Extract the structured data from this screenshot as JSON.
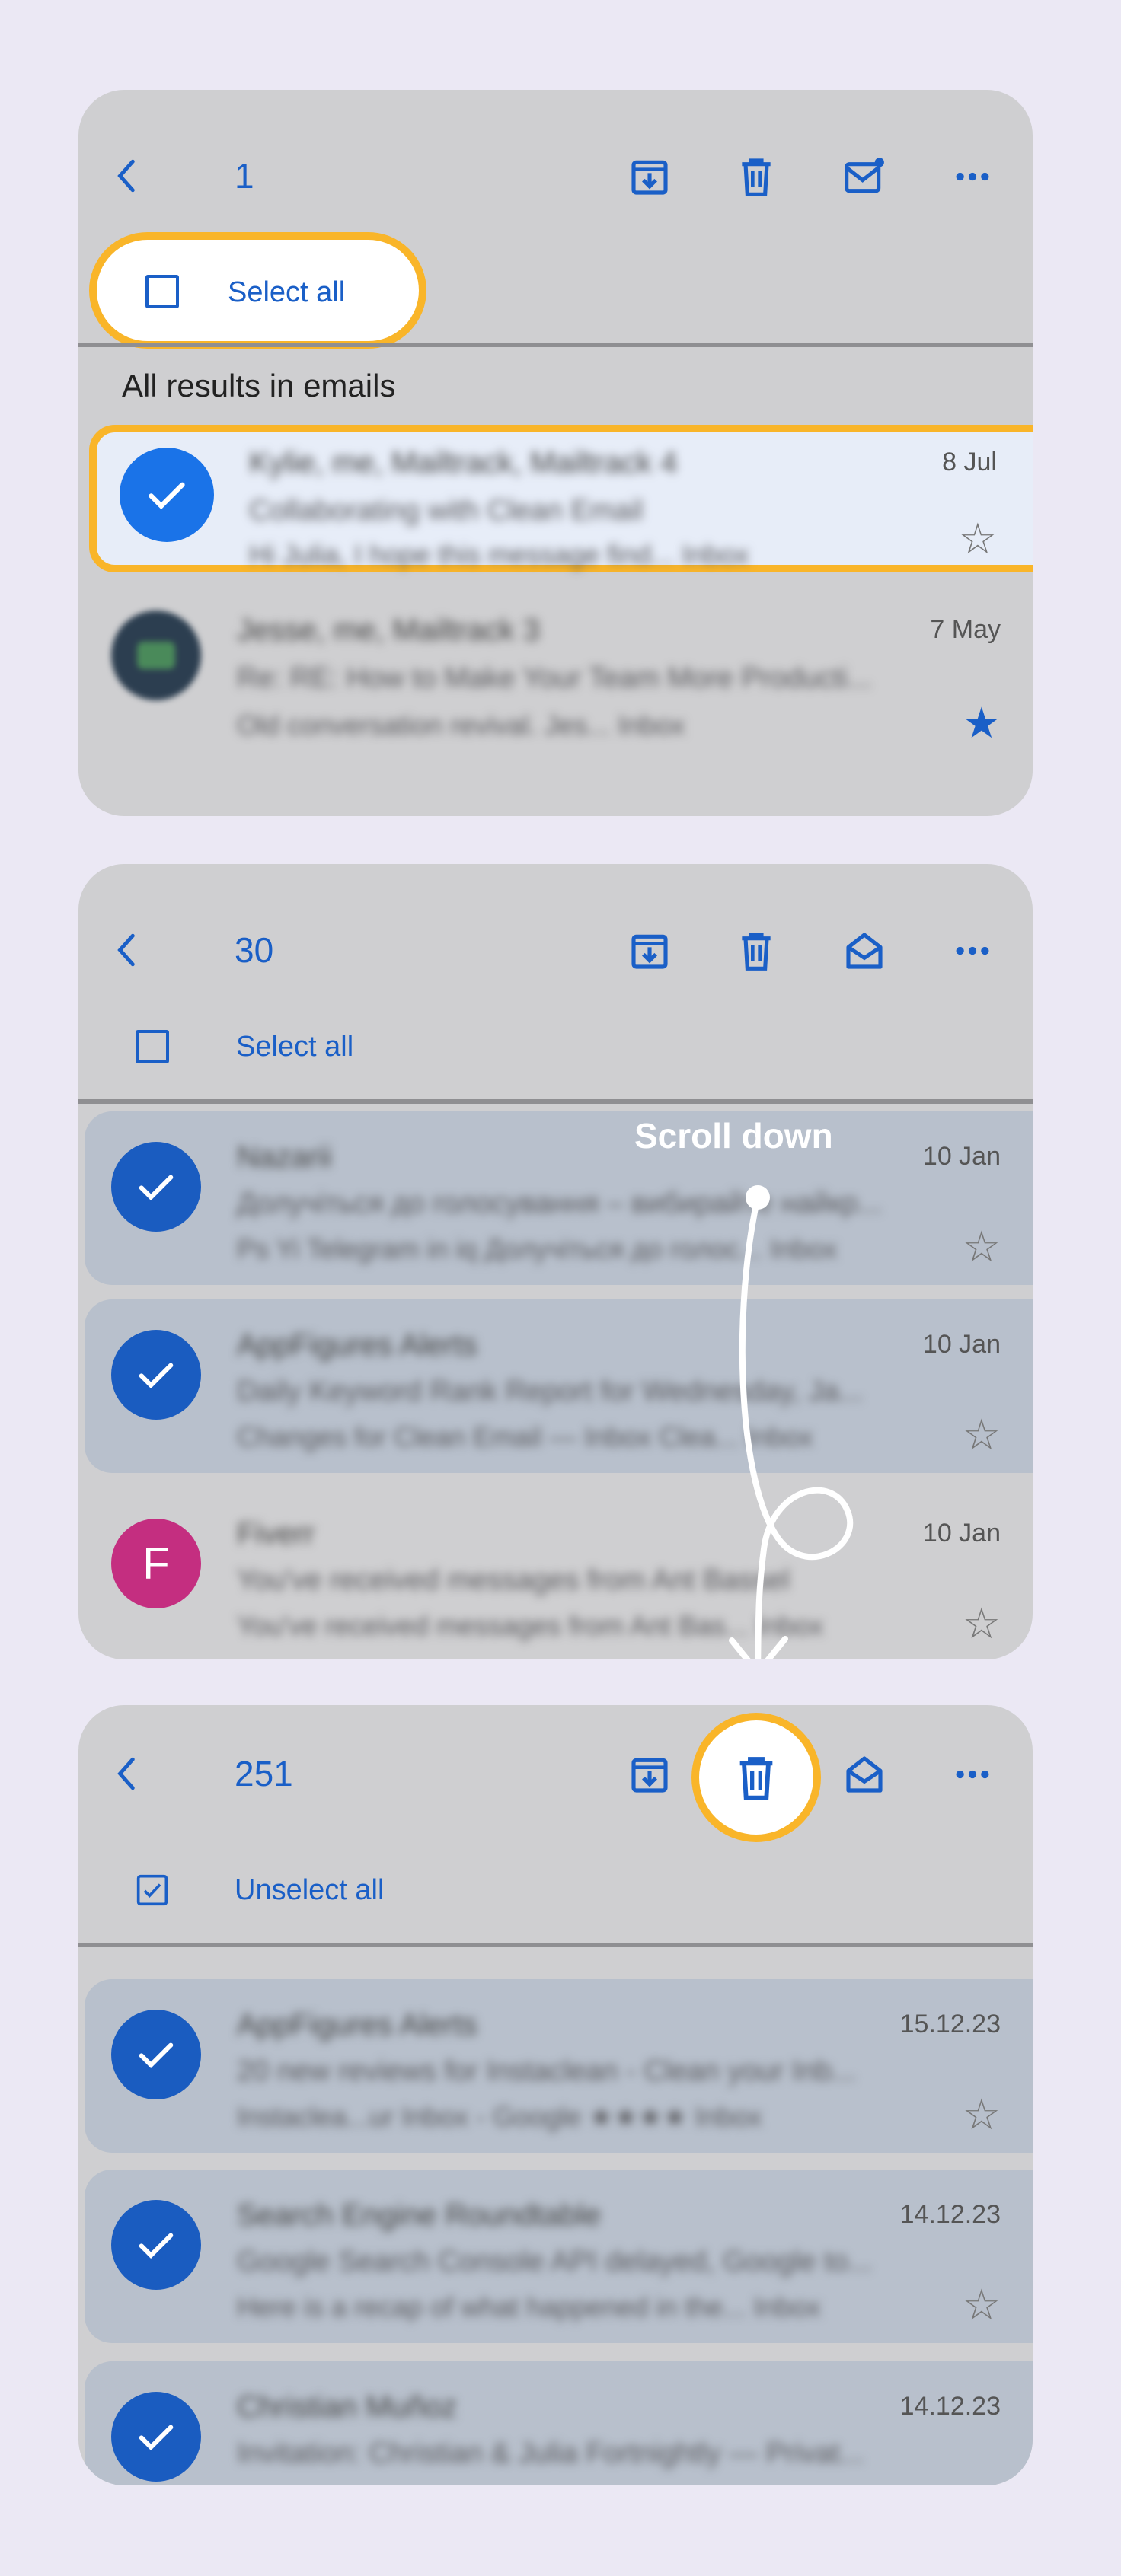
{
  "colors": {
    "accent": "#1a5fc7",
    "highlight": "#f9b529",
    "selected_row": "#b8c0cc",
    "panel": "#cfcfd1",
    "background": "#ebe8f4"
  },
  "icons": {
    "back": "chevron-left-icon",
    "archive": "archive-icon",
    "delete": "trash-icon",
    "mark_unread": "mail-unread-icon",
    "mark_read": "mail-open-icon",
    "more": "more-horizontal-icon",
    "star": "star-icon"
  },
  "panel1": {
    "count": "1",
    "select_label": "Select all",
    "section": "All results in emails",
    "rows": [
      {
        "sender": "Kylie, me, Mailtrack, Mailtrack 4",
        "subject": "Collaborating with Clean Email",
        "snippet": "Hi Julia, I hope this message find...  Inbox",
        "date": "8 Jul",
        "starred": false,
        "selected": true
      },
      {
        "sender": "Jesse, me, Mailtrack 3",
        "subject": "Re: RE: How to Make Your Team More Producti...",
        "snippet": "Old conversation revival. Jes...  Inbox",
        "date": "7 May",
        "starred": true,
        "selected": false
      }
    ]
  },
  "panel2": {
    "count": "30",
    "select_label": "Select all",
    "annotation": "Scroll down",
    "rows": [
      {
        "sender": "Nazarii",
        "subject": "Долучіться до голосування – вибирайте найкр...",
        "snippet": "Ps Yi Telegram in iq Долучіться до голос...  Inbox",
        "date": "10 Jan",
        "selected": true,
        "avatar": ""
      },
      {
        "sender": "AppFigures Alerts",
        "subject": "Daily Keyword Rank Report for Wednesday, Ja...",
        "snippet": "Changes for Clean Email — Inbox Clea...  Inbox",
        "date": "10 Jan",
        "selected": true,
        "avatar": ""
      },
      {
        "sender": "Fiverr",
        "subject": "You've received messages from Ant Bassel",
        "snippet": "You've received messages from Ant Bas...  Inbox",
        "date": "10 Jan",
        "selected": false,
        "avatar": "F"
      }
    ]
  },
  "panel3": {
    "count": "251",
    "select_label": "Unselect all",
    "rows": [
      {
        "sender": "AppFigures Alerts",
        "subject": "20 new reviews for Instaclean - Clean your Inb...",
        "snippet": "Instaclea...ur Inbox - Google  ★★★★  Inbox",
        "date": "15.12.23"
      },
      {
        "sender": "Search Engine Roundtable",
        "subject": "Google Search Console API delayed, Google to...",
        "snippet": "Here is a recap of what happened in the...  Inbox",
        "date": "14.12.23"
      },
      {
        "sender": "Christian Muñoz",
        "subject": "Invitation: Christian & Julia Fortnightly — Privat...",
        "snippet": "",
        "date": "14.12.23"
      }
    ]
  }
}
